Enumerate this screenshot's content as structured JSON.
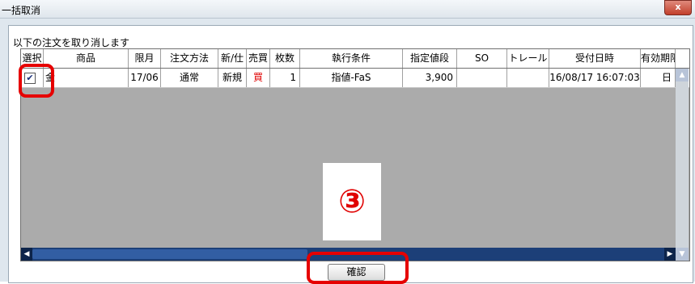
{
  "window": {
    "title": "一括取消",
    "close_label": "x"
  },
  "instruction": "以下の注文を取り消します",
  "table": {
    "headers": [
      "選択",
      "商品",
      "限月",
      "注文方法",
      "新/仕",
      "売買",
      "枚数",
      "執行条件",
      "指定値段",
      "SO",
      "トレール",
      "受付日時",
      "有効期限"
    ],
    "rows": [
      {
        "checked": true,
        "check_mark": "✔",
        "product": "金",
        "month": "17/06",
        "method": "通常",
        "new_close": "新規",
        "side": "買",
        "qty": "1",
        "condition": "指値-FaS",
        "price": "3,900",
        "so": "",
        "trail": "",
        "received": "16/08/17 16:07:03",
        "expiry": "日"
      }
    ]
  },
  "overlay": {
    "step_number": "③"
  },
  "buttons": {
    "confirm": "確認"
  },
  "colors": {
    "highlight": "#e60000",
    "buy_text": "#e00000",
    "grid_bg": "#ababab",
    "scrollbar": "#1c3f78"
  },
  "icons": {
    "close": "close-icon",
    "scroll_up": "arrow-up-icon",
    "scroll_down": "arrow-down-icon",
    "scroll_left": "arrow-left-icon",
    "scroll_right": "arrow-right-icon"
  }
}
